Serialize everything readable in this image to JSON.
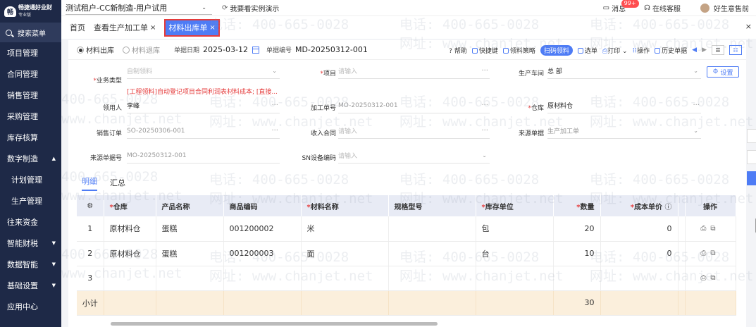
{
  "brand": {
    "name": "畅捷通好业财",
    "edition": "专业版",
    "logo_mark": "畅"
  },
  "sidebar": {
    "search_label": "搜索菜单",
    "items": [
      {
        "label": "项目管理",
        "caret": ""
      },
      {
        "label": "合同管理",
        "caret": ""
      },
      {
        "label": "销售管理",
        "caret": ""
      },
      {
        "label": "采购管理",
        "caret": ""
      },
      {
        "label": "库存核算",
        "caret": ""
      },
      {
        "label": "数字制造",
        "caret": "▲"
      },
      {
        "label": "计划管理",
        "caret": ""
      },
      {
        "label": "生产管理",
        "caret": ""
      },
      {
        "label": "往来资金",
        "caret": ""
      },
      {
        "label": "智能财税",
        "caret": "▼"
      },
      {
        "label": "数据智能",
        "caret": "▼"
      },
      {
        "label": "基础设置",
        "caret": "▼"
      },
      {
        "label": "应用中心",
        "caret": ""
      }
    ]
  },
  "topbar": {
    "tenant": "测试租户-CC新制造-用户试用",
    "tenant_caret": "⌄",
    "demo_label": "我要看实例演示",
    "messages_label": "消息",
    "messages_badge": "99+",
    "service_label": "在线客服",
    "user_label": "好生意售前"
  },
  "tabs": {
    "items": [
      {
        "label": "首页",
        "close": ""
      },
      {
        "label": "查看生产加工单",
        "close": "×"
      },
      {
        "label": "材料出库单",
        "close": "×"
      }
    ],
    "close_all": "×"
  },
  "toolbar": {
    "radio_out": "材料出库",
    "radio_return": "材料退库",
    "date_label": "单据日期",
    "date_value": "2025-03-12",
    "code_label": "单据编号",
    "code_value": "MD-20250312-001",
    "help": "帮助",
    "shortcut": "快捷键",
    "strategy": "领料策略",
    "scan": "扫码领料",
    "select": "选单",
    "print": "打印",
    "print_caret": "⌄",
    "ops": "操作",
    "history": "历史单据",
    "prev": "◀",
    "next": "▶"
  },
  "form": {
    "biz_type_label": "业务类型",
    "biz_type_value": "自制领料",
    "biz_warning": "[工程领料]自动登记项目合同利润表材料成本; [直接...",
    "project_label": "项目",
    "project_placeholder": "请输入",
    "workshop_label": "生产车间",
    "workshop_value": "总 部",
    "settings_label": "设置",
    "picker_label": "领用人",
    "picker_value": "李峰",
    "order_label": "加工单号",
    "order_value": "MO-20250312-001",
    "warehouse_label": "仓库",
    "warehouse_value": "原材料仓",
    "sales_order_label": "销售订单",
    "sales_order_value": "SO-20250306-001",
    "income_contract_label": "收入合同",
    "income_contract_placeholder": "请输入",
    "source_doc_label": "来源单据",
    "source_doc_value": "生产加工单",
    "source_no_label": "来源单据号",
    "source_no_value": "MO-20250312-001",
    "sn_label": "SN设备编码",
    "sn_placeholder": "请输入",
    "dots": "···",
    "chev": "⌄"
  },
  "subtabs": {
    "detail": "明细",
    "summary": "汇总"
  },
  "table": {
    "headers": {
      "gear": "⚙",
      "warehouse": "仓库",
      "product": "产品名称",
      "code": "商品编码",
      "material": "材料名称",
      "spec": "规格型号",
      "unit": "库存单位",
      "qty": "数量",
      "cost": "成本单价",
      "ops": "操作"
    },
    "rows": [
      {
        "idx": "1",
        "warehouse": "原材料仓",
        "product": "蛋糕",
        "code": "001200002",
        "material": "米",
        "spec": "",
        "unit": "包",
        "qty": "20",
        "cost": "0",
        "ops": "⎙⧉"
      },
      {
        "idx": "2",
        "warehouse": "原材料仓",
        "product": "蛋糕",
        "code": "001200003",
        "material": "面",
        "spec": "",
        "unit": "台",
        "qty": "10",
        "cost": "0",
        "ops": "⎙⧉"
      },
      {
        "idx": "3",
        "warehouse": "",
        "product": "",
        "code": "",
        "material": "",
        "spec": "",
        "unit": "",
        "qty": "",
        "cost": "",
        "ops": "⎙⧉"
      }
    ],
    "subtotal_label": "小计",
    "subtotal_qty": "30"
  },
  "watermark": {
    "phone": "电话: 400-665-0028",
    "site": "网址: www.chanjet.net",
    "phone_short": "400-665-0028",
    "site_short": "www.chanjet.net"
  },
  "colors": {
    "accent": "#4e7cf5",
    "sidebar": "#1e2947",
    "required": "#e53b3b",
    "subtotal": "#fbefdc"
  }
}
